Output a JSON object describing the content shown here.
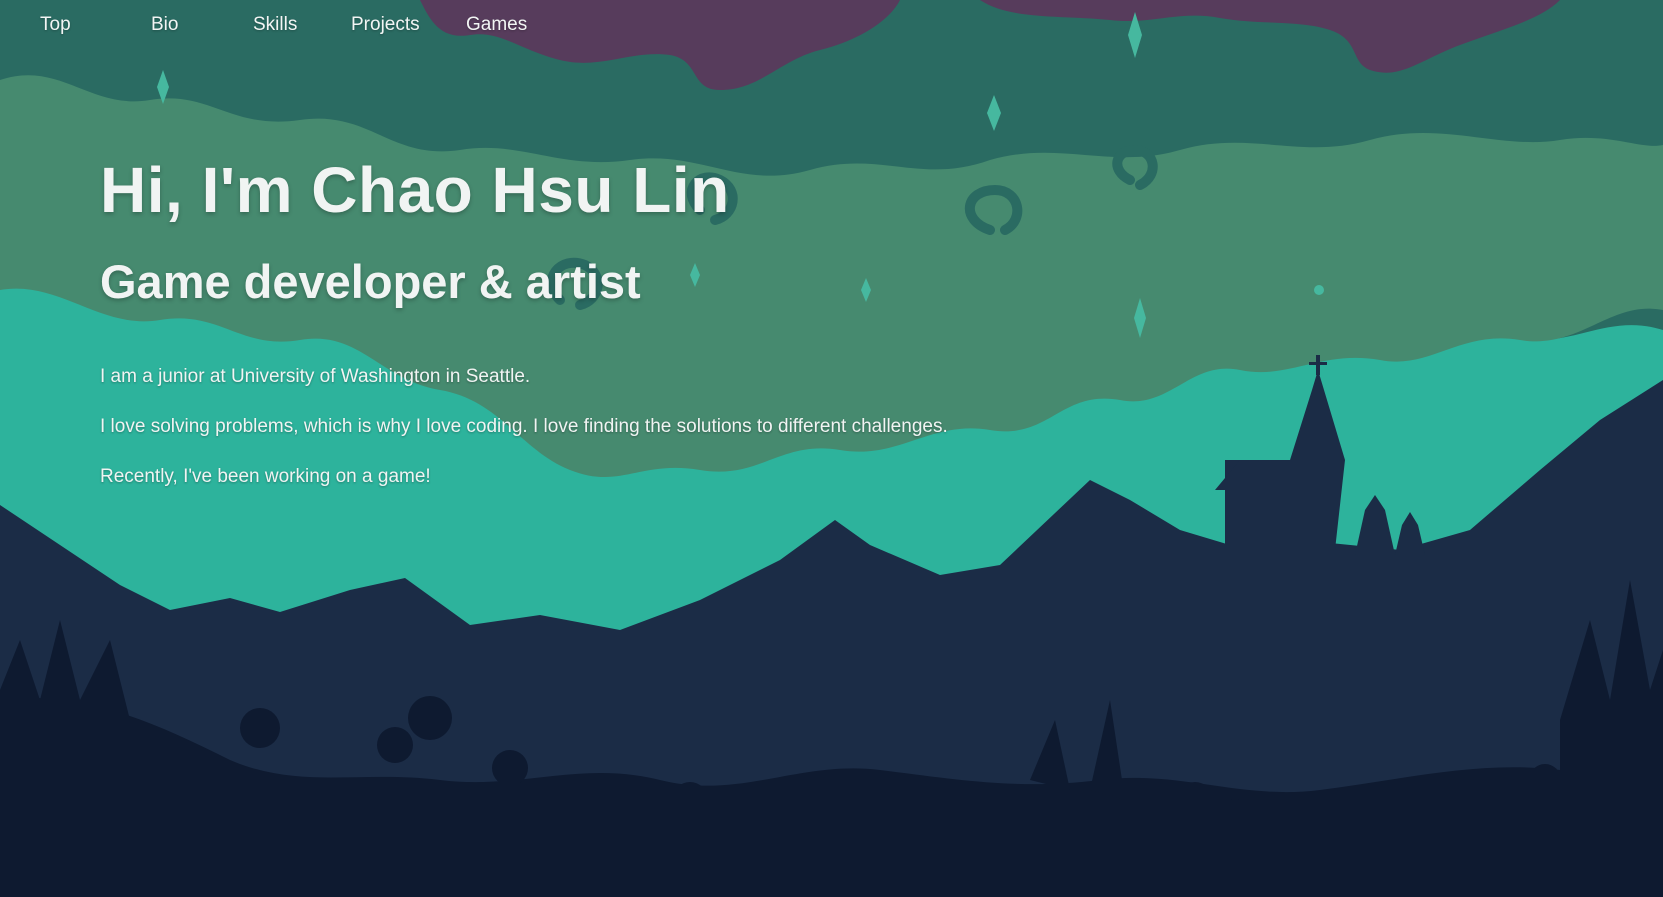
{
  "nav": {
    "items": [
      {
        "label": "Top"
      },
      {
        "label": "Bio"
      },
      {
        "label": "Skills"
      },
      {
        "label": "Projects"
      },
      {
        "label": "Games"
      }
    ]
  },
  "hero": {
    "title": "Hi, I'm Chao Hsu Lin",
    "subtitle": "Game developer & artist",
    "paragraphs": [
      "I am a junior at University of Washington in Seattle.",
      "I love solving problems, which is why I love coding. I love finding the solutions to different challenges.",
      "Recently, I've been working on a game!"
    ]
  },
  "colors": {
    "sky_purple": "#573c5c",
    "sky_dark_green": "#2a6b62",
    "cloud_green": "#468a6f",
    "teal": "#2db39c",
    "mountain_navy": "#1b2c46",
    "foreground_dark": "#0e1a30"
  }
}
